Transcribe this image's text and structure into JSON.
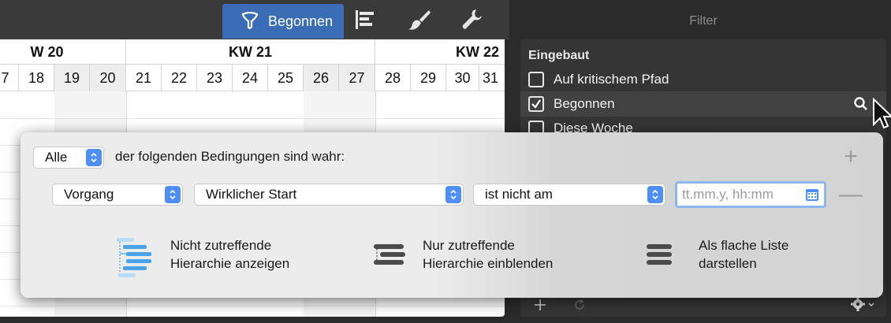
{
  "toolbar": {
    "active_filter_label": "Begonnen",
    "icons": [
      "filter-icon",
      "gantt-icon",
      "brush-icon",
      "wrench-icon"
    ]
  },
  "calendar": {
    "weeks": [
      {
        "label": "W 20"
      },
      {
        "label": "KW 21"
      },
      {
        "label": "KW 22"
      }
    ],
    "days": [
      "7",
      "18",
      "19",
      "20",
      "21",
      "22",
      "23",
      "24",
      "25",
      "26",
      "27",
      "28",
      "29",
      "30",
      "31"
    ],
    "weekend_days": [
      "19",
      "20",
      "26",
      "27"
    ]
  },
  "filter_panel": {
    "title": "Filter",
    "section_heading": "Eingebaut",
    "items": [
      {
        "label": "Auf kritischem Pfad",
        "checked": false
      },
      {
        "label": "Begonnen",
        "checked": true
      },
      {
        "label": "Diese Woche",
        "checked": false
      }
    ],
    "bottom_icons": [
      "plus-icon",
      "refresh-icon",
      "gear-icon"
    ]
  },
  "popover": {
    "match_select": "Alle",
    "match_text": "der folgenden Bedingungen sind wahr:",
    "condition": {
      "field_category": "Vorgang",
      "field": "Wirklicher Start",
      "operator": "ist nicht am",
      "date_placeholder": "tt.mm.y, hh:mm"
    },
    "add_button": "+",
    "remove_button": "—",
    "options": [
      {
        "line1": "Nicht zutreffende",
        "line2": "Hierarchie anzeigen",
        "icon": "hierarchy-show-icon",
        "selected": true
      },
      {
        "line1": "Nur zutreffende",
        "line2": "Hierarchie einblenden",
        "icon": "hierarchy-collapse-icon",
        "selected": false
      },
      {
        "line1": "Als flache Liste",
        "line2": "darstellen",
        "icon": "flat-list-icon",
        "selected": false
      }
    ]
  },
  "colors": {
    "accent": "#3a6db5",
    "popup_arrow": "#4f8ef7",
    "selected_option_icon": "#4aa3e8"
  }
}
